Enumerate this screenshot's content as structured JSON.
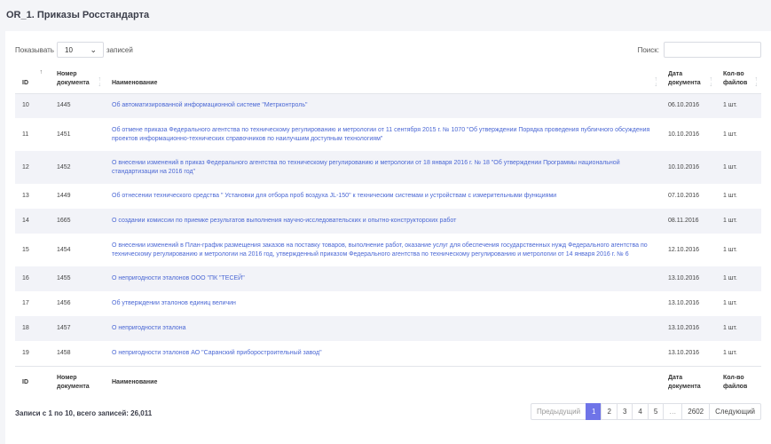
{
  "page": {
    "title": "OR_1. Приказы Росстандарта"
  },
  "length_menu": {
    "label": "Показывать",
    "value": "10",
    "suffix": "записей"
  },
  "search": {
    "label": "Поиск:",
    "value": ""
  },
  "table": {
    "columns": [
      "ID",
      "Номер документа",
      "Наименование",
      "Дата документа",
      "Кол-во файлов"
    ],
    "rows": [
      {
        "id": "10",
        "number": "1445",
        "name": "Об автоматизированной информационной системе \"Метрконтроль\"",
        "date": "06.10.2016",
        "files": "1 шт."
      },
      {
        "id": "11",
        "number": "1451",
        "name": "Об отмене приказа Федерального агентства по техническому регулированию и метрологии от 11 сентября 2015 г. № 1070 \"Об утверждении Порядка проведения публичного обсуждения проектов информационно-технических справочников по наилучшим доступным технологиям\"",
        "date": "10.10.2016",
        "files": "1 шт."
      },
      {
        "id": "12",
        "number": "1452",
        "name": "О внесении изменений в приказ Федерального агентства по техническому регулированию и метрологии от 18 января 2016 г. № 18 \"Об утверждении Программы национальной стандартизации на 2016 год\"",
        "date": "10.10.2016",
        "files": "1 шт."
      },
      {
        "id": "13",
        "number": "1449",
        "name": "Об отнесении технического средства \" Установки для отбора проб воздуха JL-150\" к техническим системам и устройствам с измерительными функциями",
        "date": "07.10.2016",
        "files": "1 шт."
      },
      {
        "id": "14",
        "number": "1665",
        "name": "О создании комиссии по приемке результатов выполнения научно-исследовательских и опытно-конструкторских работ",
        "date": "08.11.2016",
        "files": "1 шт."
      },
      {
        "id": "15",
        "number": "1454",
        "name": "О внесении изменений в План-график размещения заказов на поставку товаров, выполнение работ, оказание услуг для обеспечения государственных нужд Федерального агентства по техническому регулированию и метрологии на 2016 год, утвержденный приказом Федерального агентства по техническому регулированию и метрологии от 14 января 2016 г. № 6",
        "date": "12.10.2016",
        "files": "1 шт."
      },
      {
        "id": "16",
        "number": "1455",
        "name": "О непригодности эталонов ООО \"ПК \"ТЕСЕЙ\"",
        "date": "13.10.2016",
        "files": "1 шт."
      },
      {
        "id": "17",
        "number": "1456",
        "name": "Об утверждении эталонов единиц величин",
        "date": "13.10.2016",
        "files": "1 шт."
      },
      {
        "id": "18",
        "number": "1457",
        "name": "О непригодности эталона",
        "date": "13.10.2016",
        "files": "1 шт."
      },
      {
        "id": "19",
        "number": "1458",
        "name": "О непригодности эталонов АО \"Саранский приборостроительный завод\"",
        "date": "13.10.2016",
        "files": "1 шт."
      }
    ]
  },
  "footer": {
    "info": "Записи с 1 по 10, всего записей: 26,011"
  },
  "pagination": {
    "prev": "Предыдущий",
    "pages": [
      "1",
      "2",
      "3",
      "4",
      "5",
      "…",
      "2602"
    ],
    "active": "1",
    "next": "Следующий"
  },
  "colors": {
    "accent": "#6f74e8",
    "link": "#4a67d4",
    "stripe": "#f2f3f8"
  },
  "icons": {
    "select_chevron": "chevron-down-icon",
    "sort": "sort-icon"
  }
}
